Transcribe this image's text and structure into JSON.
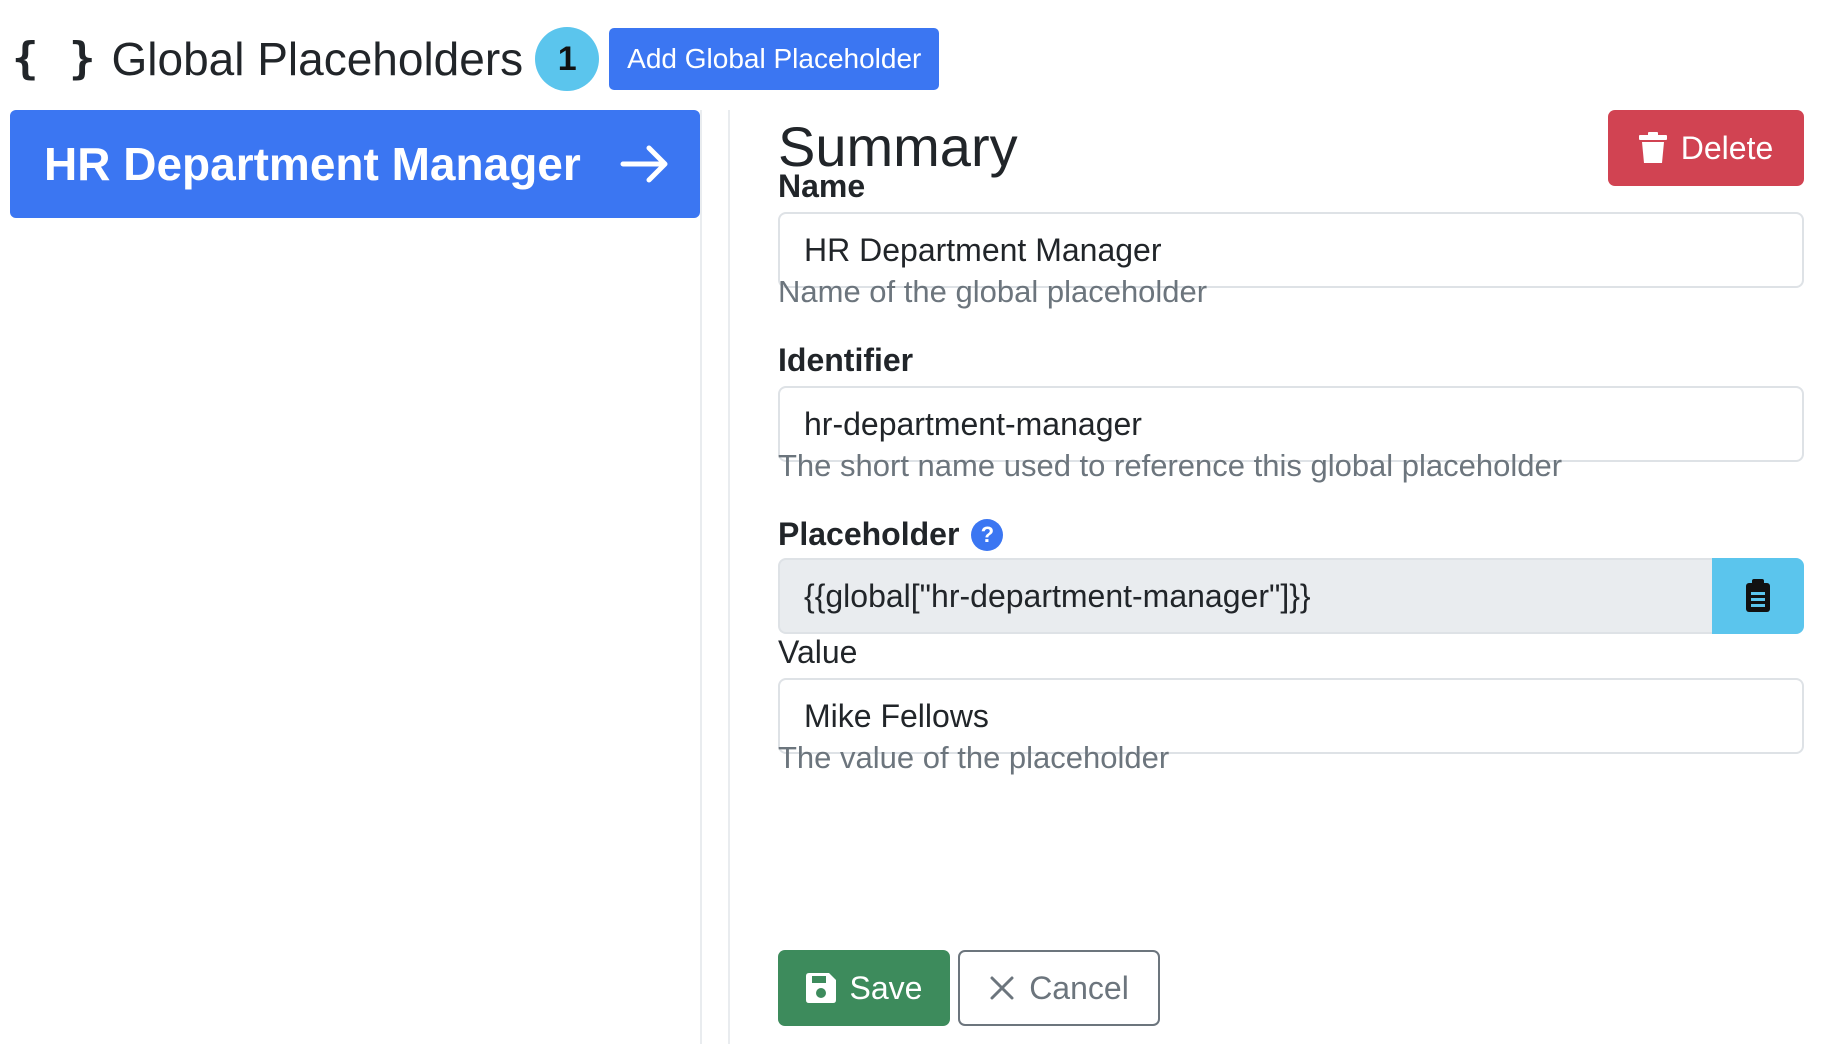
{
  "header": {
    "icon_text": "{ }",
    "title": "Global Placeholders",
    "count": "1",
    "add_button_label": "Add Global Placeholder"
  },
  "list": {
    "items": [
      {
        "label": "HR Department Manager",
        "icon": "arrow-right-icon"
      }
    ]
  },
  "summary": {
    "title": "Summary",
    "delete_label": "Delete",
    "name": {
      "label": "Name",
      "value": "HR Department Manager",
      "help": "Name of the global placeholder"
    },
    "identifier": {
      "label": "Identifier",
      "value": "hr-department-manager",
      "help": "The short name used to reference this global placeholder"
    },
    "placeholder": {
      "label": "Placeholder",
      "help_icon": "?",
      "value": "{{global[\"hr-department-manager\"]}}"
    },
    "value": {
      "label": "Value",
      "value": "Mike Fellows",
      "help": "The value of the placeholder"
    },
    "save_label": "Save",
    "cancel_label": "Cancel"
  },
  "colors": {
    "primary": "#3b76f2",
    "info": "#5bc5ed",
    "danger": "#d14352",
    "success": "#3d8b5c"
  }
}
